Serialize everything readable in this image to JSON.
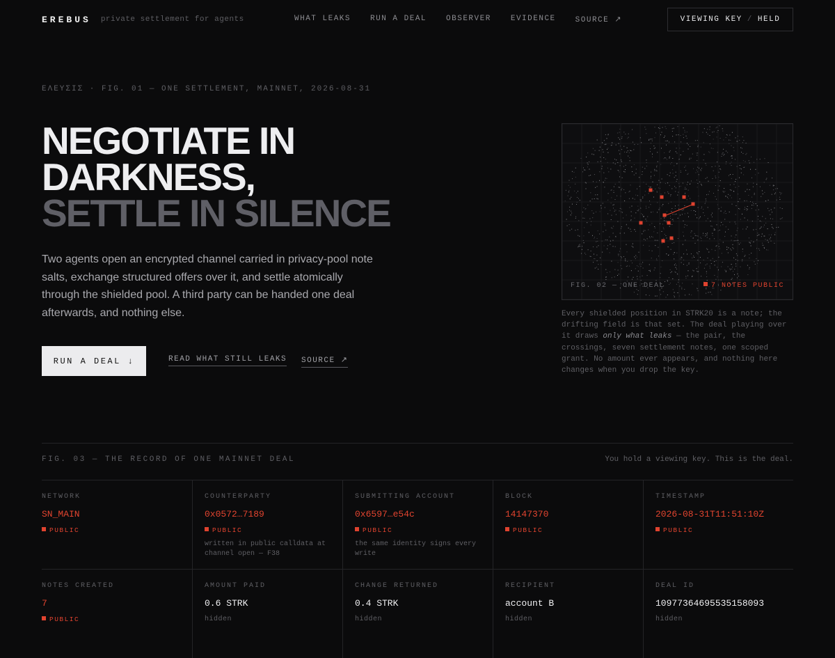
{
  "header": {
    "brand": "EREBUS",
    "tagline": "private settlement for agents",
    "nav": [
      "WHAT LEAKS",
      "RUN A DEAL",
      "OBSERVER",
      "EVIDENCE",
      "SOURCE ↗"
    ],
    "viewing_key": {
      "label": "VIEWING KEY",
      "separator": "/",
      "state": "HELD"
    }
  },
  "hero": {
    "eyebrow": "ΕΛΕΥΣΙΣ · FIG. 01 — ONE SETTLEMENT, MAINNET, 2026-08-31",
    "headline": [
      "NEGOTIATE IN",
      "DARKNESS,",
      "SETTLE IN SILENCE"
    ],
    "lede": "Two agents open an encrypted channel carried in privacy-pool note salts, exchange structured offers over it, and settle atomically through the shielded pool. A third party can be handed one deal afterwards, and nothing else.",
    "cta_primary": "RUN A DEAL ↓",
    "cta_leaks": "READ WHAT STILL LEAKS",
    "cta_source": "SOURCE ↗"
  },
  "figure2": {
    "caption": "FIG. 02 — ONE DEAL",
    "flag": "7 NOTES PUBLIC",
    "desc_before": "Every shielded position in STRK20 is a note; the drifting field is that set. The deal playing over it draws ",
    "desc_em": "only what leaks",
    "desc_after": " — the pair, the crossings, seven settlement notes, one scoped grant. No amount ever appears, and nothing here changes when you drop the key.",
    "accent": "#e0432f"
  },
  "record": {
    "title": "FIG. 03 — THE RECORD OF ONE MAINNET DEAL",
    "note": "You hold a viewing key. This is the deal.",
    "row1": [
      {
        "label": "NETWORK",
        "value": "SN_MAIN",
        "tag": "PUBLIC",
        "note": ""
      },
      {
        "label": "COUNTERPARTY",
        "value": "0x0572…7189",
        "tag": "PUBLIC",
        "note": "written in public calldata at channel open — F38"
      },
      {
        "label": "SUBMITTING ACCOUNT",
        "value": "0x6597…e54c",
        "tag": "PUBLIC",
        "note": "the same identity signs every write"
      },
      {
        "label": "BLOCK",
        "value": "14147370",
        "tag": "PUBLIC",
        "note": ""
      },
      {
        "label": "TIMESTAMP",
        "value": "2026-08-31T11:51:10Z",
        "tag": "PUBLIC",
        "note": ""
      }
    ],
    "row2": [
      {
        "label": "NOTES CREATED",
        "value": "7",
        "tag": "PUBLIC"
      },
      {
        "label": "AMOUNT PAID",
        "value": "0.6 STRK",
        "tag": "hidden"
      },
      {
        "label": "CHANGE RETURNED",
        "value": "0.4 STRK",
        "tag": "hidden"
      },
      {
        "label": "RECIPIENT",
        "value": "account B",
        "tag": "hidden"
      },
      {
        "label": "DEAL ID",
        "value": "10977364695535158093",
        "tag": "hidden"
      }
    ]
  }
}
